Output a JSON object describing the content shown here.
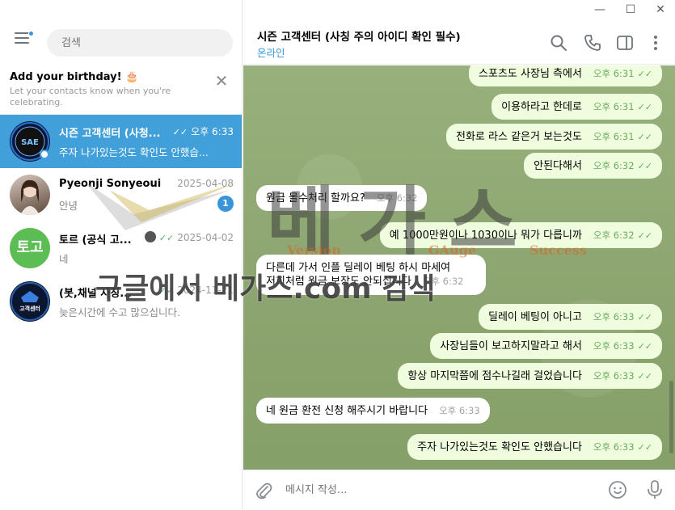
{
  "window": {
    "minimize": "—",
    "maximize": "☐",
    "close": "✕"
  },
  "sidebar": {
    "search_placeholder": "검색",
    "birthday": {
      "title": "Add your birthday! 🎂",
      "subtitle": "Let your contacts know when you're celebrating."
    },
    "chats": [
      {
        "name": "시즌 고객센터 (사청...",
        "time": "오후 6:33",
        "preview": "주자 나가있는것도 확인도 안했습...",
        "active": true,
        "avatar_text": "SAE"
      },
      {
        "name": "Pyeonji Sonyeoui",
        "time": "2025-04-08",
        "preview": "안녕",
        "unread": "1"
      },
      {
        "name": "토르 (공식 고...",
        "time": "2025-04-02",
        "preview": "네",
        "avatar_text": "토고"
      },
      {
        "name": "(봇,채널 사칭...",
        "time": "2024-11-21",
        "preview": "늦은시간에 수고 많으십니다.",
        "avatar_text": "고객센터"
      }
    ]
  },
  "header": {
    "title": "시즌 고객센터 (사칭 주의 아이디 확인 필수)",
    "status": "온라인"
  },
  "messages": [
    {
      "dir": "out",
      "text": "스포츠도 사장님 측에서",
      "time": "오후 6:31"
    },
    {
      "dir": "out",
      "text": "이용하라고 한데로",
      "time": "오후 6:31"
    },
    {
      "dir": "out",
      "text": "전화로 라스 같은거 보는것도",
      "time": "오후 6:31"
    },
    {
      "dir": "out",
      "text": "안된다해서",
      "time": "오후 6:32"
    },
    {
      "dir": "in",
      "text": "원금 몰수처리 할까요?",
      "time": "오후 6:32"
    },
    {
      "dir": "out",
      "text": "예 1000만원이나 1030이나 뭐가 다릅니까",
      "time": "오후 6:32"
    },
    {
      "dir": "in",
      "text": "다른데 가서 인플 딜레이 베팅 하시 마세여",
      "text2": "저희처럼 원금 보장도 안되십니다",
      "time": "오후 6:32"
    },
    {
      "dir": "out",
      "text": "딜레이 베팅이 아니고",
      "time": "오후 6:33"
    },
    {
      "dir": "out",
      "text": "사장님들이 보고하지말라고 해서",
      "time": "오후 6:33"
    },
    {
      "dir": "out",
      "text": "항상 마지막쯤에 점수나길래 걸었습니다",
      "time": "오후 6:33"
    },
    {
      "dir": "in",
      "text": "네 원금 환전 신청 해주시기 바랍니다",
      "time": "오후 6:33"
    },
    {
      "dir": "out",
      "text": "주자 나가있는것도 확인도 안했습니다",
      "time": "오후 6:33"
    }
  ],
  "composer": {
    "placeholder": "메시지 작성..."
  },
  "watermark": {
    "brand": "베가스",
    "sub1": "Version",
    "sub2": "GAuge",
    "sub3": "Success",
    "slogan": "구글에서 베가스.com 검색"
  },
  "colors": {
    "accent": "#419fd9",
    "out_bubble": "#effdde",
    "chat_bg": "#8fa773",
    "check": "#5fb25c"
  }
}
